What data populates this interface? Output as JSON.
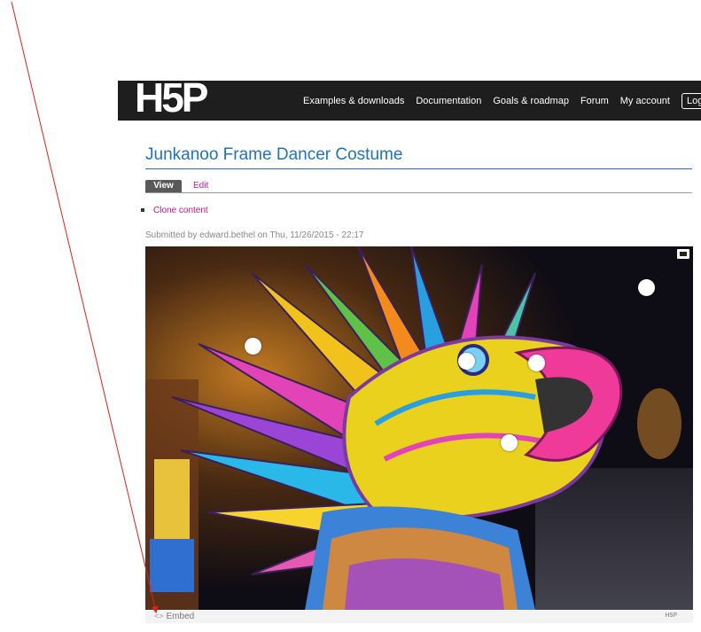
{
  "header": {
    "logo": "H5P",
    "nav": [
      "Examples & downloads",
      "Documentation",
      "Goals & roadmap",
      "Forum",
      "My account"
    ],
    "logout": "Log out"
  },
  "page": {
    "title": "Junkanoo Frame Dancer Costume",
    "tabs": {
      "view": "View",
      "edit": "Edit"
    },
    "actions": [
      "Clone content"
    ],
    "submitted": "Submitted by edward.bethel on Thu, 11/26/2015 - 22:17"
  },
  "image": {
    "description": "Junkanoo Frame Dancer Costume",
    "hotspot_count": 5
  },
  "footer": {
    "embed": "Embed",
    "brand": "H5P"
  },
  "colors": {
    "link": "#c0168f",
    "title": "#1f73b8",
    "header_bg": "#1e1e1e"
  }
}
